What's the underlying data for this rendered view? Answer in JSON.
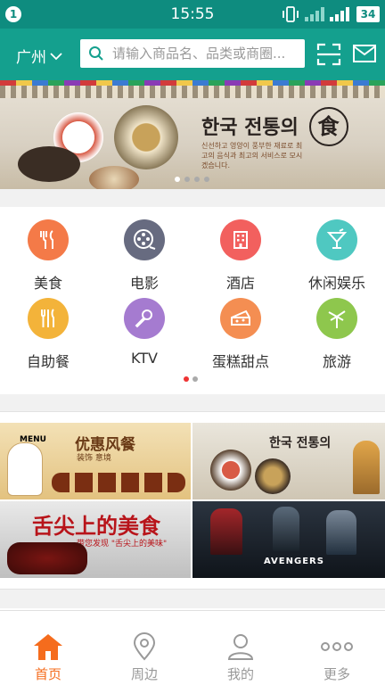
{
  "status": {
    "notification_count": "1",
    "time": "15:55",
    "battery": "34"
  },
  "header": {
    "city": "广州",
    "search_placeholder": "请输入商品名、品类或商圈..."
  },
  "banner": {
    "title": "한국 전통의",
    "title_badge": "食",
    "text": "신선하고 영양이 풍부한 재료로 최고의 음식과 최고의 서비스로 모시겠습니다.",
    "slide_count": 4,
    "active_slide": 0
  },
  "categories": [
    {
      "label": "美食",
      "icon": "utensils-icon",
      "color": "#f47a48"
    },
    {
      "label": "电影",
      "icon": "film-reel-icon",
      "color": "#676b80"
    },
    {
      "label": "酒店",
      "icon": "hotel-building-icon",
      "color": "#f2605e"
    },
    {
      "label": "休闲娱乐",
      "icon": "cocktail-icon",
      "color": "#4fc8c1"
    },
    {
      "label": "自助餐",
      "icon": "buffet-icon",
      "color": "#f3b33a"
    },
    {
      "label": "KTV",
      "icon": "microphone-icon",
      "color": "#a57bd0"
    },
    {
      "label": "蛋糕甜点",
      "icon": "cake-icon",
      "color": "#f48e52"
    },
    {
      "label": "旅游",
      "icon": "palm-tree-icon",
      "color": "#8ec74d"
    }
  ],
  "category_pages": {
    "count": 2,
    "active": 0
  },
  "promos": {
    "tile1": {
      "badge": "MENU",
      "title": "优惠风餐",
      "sub": "装饰 意境"
    },
    "tile2": {
      "title": "한국 전통의"
    },
    "tile3": {
      "title": "舌尖上的美食",
      "sub": "带您发现 \"舌尖上的美味\""
    },
    "tile4": {
      "title": "AVENGERS"
    }
  },
  "tabs": [
    {
      "label": "首页",
      "icon": "home-icon",
      "active": true
    },
    {
      "label": "周边",
      "icon": "location-pin-icon",
      "active": false
    },
    {
      "label": "我的",
      "icon": "user-icon",
      "active": false
    },
    {
      "label": "更多",
      "icon": "more-dots-icon",
      "active": false
    }
  ],
  "colors": {
    "header": "#14a08e",
    "statusbar": "#0e8c7f",
    "active_tab": "#f56c1d"
  }
}
